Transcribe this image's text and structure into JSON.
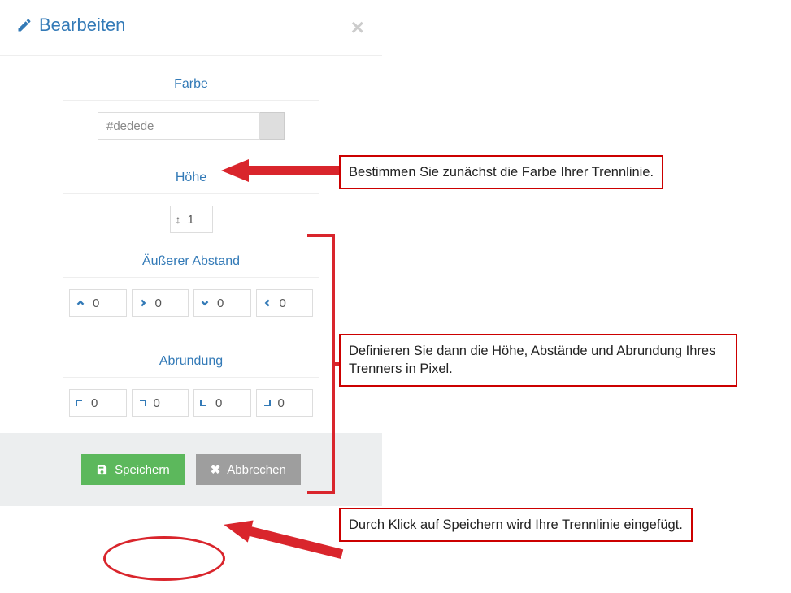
{
  "dialog": {
    "title": "Bearbeiten",
    "sections": {
      "color": {
        "label": "Farbe",
        "value": "#dedede"
      },
      "height": {
        "label": "Höhe",
        "value": "1"
      },
      "margin": {
        "label": "Äußerer Abstand",
        "top": "0",
        "right": "0",
        "bottom": "0",
        "left": "0"
      },
      "rounding": {
        "label": "Abrundung",
        "tl": "0",
        "tr": "0",
        "bl": "0",
        "br": "0"
      }
    },
    "buttons": {
      "save": "Speichern",
      "cancel": "Abbrechen"
    }
  },
  "annotations": {
    "a1": "Bestimmen Sie zunächst die Farbe Ihrer Trennlinie.",
    "a2": "Definieren Sie dann die Höhe, Abstände und Abrundung Ihres Trenners in Pixel.",
    "a3": "Durch Klick auf Speichern wird Ihre Trennlinie eingefügt."
  }
}
